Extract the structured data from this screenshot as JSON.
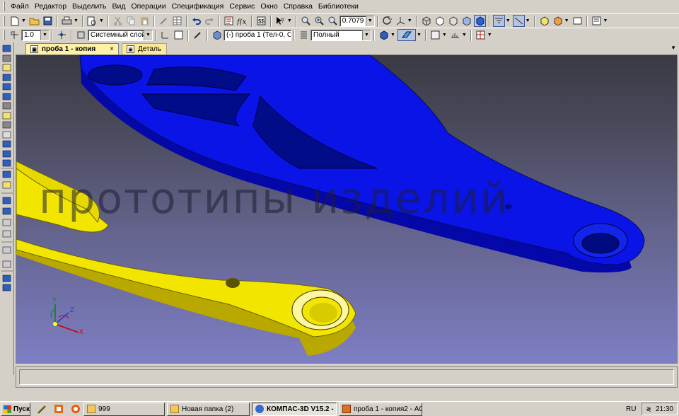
{
  "menubar": {
    "items": [
      "Файл",
      "Редактор",
      "Выделить",
      "Вид",
      "Операции",
      "Спецификация",
      "Сервис",
      "Окно",
      "Справка",
      "Библиотеки"
    ]
  },
  "toolbar1": {
    "zoom_value": "0.7079"
  },
  "toolbar2": {
    "step_value": "1.0",
    "layer_value": "Системный слой (0)",
    "part_value": "(-) проба 1 (Тел-0, С",
    "mode_value": "Полный"
  },
  "tabs": [
    {
      "label": "проба 1 - копия",
      "close": "×",
      "active": true
    },
    {
      "label": "Деталь",
      "active": false
    }
  ],
  "viewport": {
    "watermark": "прототипы изделий",
    "axes": {
      "x": "X",
      "y": "Y",
      "z": "Z"
    },
    "part_colors": {
      "blue_part": "#0a14e6",
      "yellow_part": "#f2e600"
    }
  },
  "taskbar": {
    "start_label": "Пуск",
    "buttons": [
      {
        "label": "999",
        "icon": "folder-icon",
        "pressed": false
      },
      {
        "label": "Новая папка (2)",
        "icon": "folder-icon",
        "pressed": false
      },
      {
        "label": "КОМПАС-3D V15.2 - п...",
        "icon": "kompas-icon",
        "pressed": true
      },
      {
        "label": "проба 1 - копия2 - ACD...",
        "icon": "acd-icon",
        "pressed": false
      }
    ],
    "language": "RU",
    "time": "21:30"
  }
}
